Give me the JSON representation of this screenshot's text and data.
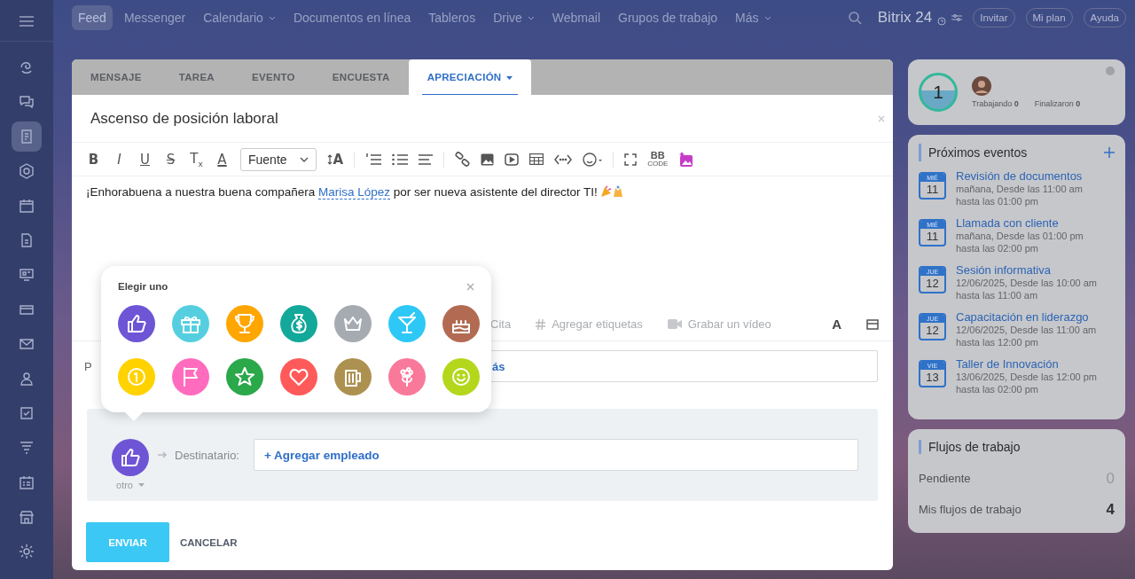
{
  "sidebar": {
    "items": [
      {
        "selected": false
      },
      {
        "selected": false
      },
      {
        "selected": true
      },
      {
        "selected": false
      },
      {
        "selected": false
      },
      {
        "selected": false
      },
      {
        "selected": false
      },
      {
        "selected": false
      },
      {
        "selected": false
      },
      {
        "selected": false
      },
      {
        "selected": false
      },
      {
        "selected": false
      },
      {
        "selected": false
      },
      {
        "selected": false
      },
      {
        "selected": false
      }
    ]
  },
  "top_nav": {
    "items": [
      {
        "label": "Feed",
        "selected": true,
        "dropdown": false
      },
      {
        "label": "Messenger",
        "selected": false,
        "dropdown": false
      },
      {
        "label": "Calendario",
        "selected": false,
        "dropdown": true
      },
      {
        "label": "Documentos en línea",
        "selected": false,
        "dropdown": false
      },
      {
        "label": "Tableros",
        "selected": false,
        "dropdown": false
      },
      {
        "label": "Drive",
        "selected": false,
        "dropdown": true
      },
      {
        "label": "Webmail",
        "selected": false,
        "dropdown": false
      },
      {
        "label": "Grupos de trabajo",
        "selected": false,
        "dropdown": false
      },
      {
        "label": "Más",
        "selected": false,
        "dropdown": true
      }
    ],
    "logo": "Bitrix 24",
    "buttons": [
      "Invitar",
      "Mi plan",
      "Ayuda"
    ]
  },
  "form": {
    "tabs": [
      {
        "label": "MENSAJE",
        "selected": false,
        "dropdown": false
      },
      {
        "label": "TAREA",
        "selected": false,
        "dropdown": false
      },
      {
        "label": "EVENTO",
        "selected": false,
        "dropdown": false
      },
      {
        "label": "ENCUESTA",
        "selected": false,
        "dropdown": false
      },
      {
        "label": "APRECIACIÓN",
        "selected": true,
        "dropdown": true
      }
    ],
    "title": "Ascenso de posición laboral",
    "format_buttons": [
      {
        "kind": "bold",
        "label": "B"
      },
      {
        "kind": "italic",
        "label": "I"
      },
      {
        "kind": "underline",
        "label": "U"
      },
      {
        "kind": "strike",
        "label": "S"
      },
      {
        "kind": "clear",
        "label": "T$_{x}$"
      },
      {
        "kind": "color",
        "label": "A"
      }
    ],
    "font_select": "Fuente",
    "size_button": "A",
    "bbcode": [
      "BB",
      "CODE"
    ],
    "body": {
      "before": "¡Enhorabuena a nuestra buena compañera ",
      "mention": "Marisa López",
      "after": " por ser nueva asistente del director TI!"
    },
    "extras": [
      {
        "kind": "quote",
        "label": "Cita"
      },
      {
        "kind": "tags",
        "label": "Agregar etiquetas"
      },
      {
        "kind": "video",
        "label": "Grabar un vídeo"
      }
    ],
    "text_button": "A",
    "hidden_field": {
      "label": "P",
      "value": "ás"
    },
    "badge_picker": {
      "title": "Elegir uno",
      "badges": [
        {
          "kind": "thumbs",
          "color": "#6e55d6"
        },
        {
          "kind": "gift",
          "color": "#55cfe0"
        },
        {
          "kind": "trophy",
          "color": "#ffa600"
        },
        {
          "kind": "money",
          "color": "#12a89a"
        },
        {
          "kind": "crown",
          "color": "#a6abb2"
        },
        {
          "kind": "cocktail",
          "color": "#2ec8f6"
        },
        {
          "kind": "cake",
          "color": "#b26b52"
        },
        {
          "kind": "coin",
          "color": "#ffd200"
        },
        {
          "kind": "flag",
          "color": "#ff6cbe"
        },
        {
          "kind": "star",
          "color": "#2aa84a"
        },
        {
          "kind": "heart",
          "color": "#ff5a5a"
        },
        {
          "kind": "beer",
          "color": "#ad9150"
        },
        {
          "kind": "flower",
          "color": "#f9799b"
        },
        {
          "kind": "smile",
          "color": "#b4d71c"
        }
      ]
    },
    "recipient": {
      "badge": {
        "kind": "thumbs",
        "color": "#6e55d6"
      },
      "badge_label": "otro",
      "label": "Destinatario:",
      "add": "+ Agregar empleado"
    },
    "submit": "ENVIAR",
    "cancel": "CANCELAR"
  },
  "widgets": {
    "counter": {
      "value": "1",
      "working_label": "Trabajando",
      "working": "0",
      "finished_label": "Finalizaron",
      "finished": "0"
    },
    "events": {
      "title": "Próximos eventos",
      "items": [
        {
          "weekday": "MIÉ",
          "day": "11",
          "title": "Revisión de documentos",
          "from": "mañana, Desde las 11:00 am",
          "until": "hasta las 01:00 pm"
        },
        {
          "weekday": "MIÉ",
          "day": "11",
          "title": "Llamada con cliente",
          "from": "mañana, Desde las 01:00 pm",
          "until": "hasta las 02:00 pm"
        },
        {
          "weekday": "JUE",
          "day": "12",
          "title": "Sesión informativa",
          "from": "12/06/2025, Desde las 10:00 am",
          "until": "hasta las 11:00 am"
        },
        {
          "weekday": "JUE",
          "day": "12",
          "title": "Capacitación en liderazgo",
          "from": "12/06/2025, Desde las 11:00 am",
          "until": "hasta las 12:00 pm"
        },
        {
          "weekday": "VIE",
          "day": "13",
          "title": "Taller de Innovación",
          "from": "13/06/2025, Desde las 12:00 pm",
          "until": "hasta las 02:00 pm"
        }
      ]
    },
    "workflows": {
      "title": "Flujos de trabajo",
      "rows": [
        {
          "label": "Pendiente",
          "count": "0",
          "muted": true
        },
        {
          "label": "Mis flujos de trabajo",
          "count": "4",
          "muted": false
        }
      ]
    }
  }
}
